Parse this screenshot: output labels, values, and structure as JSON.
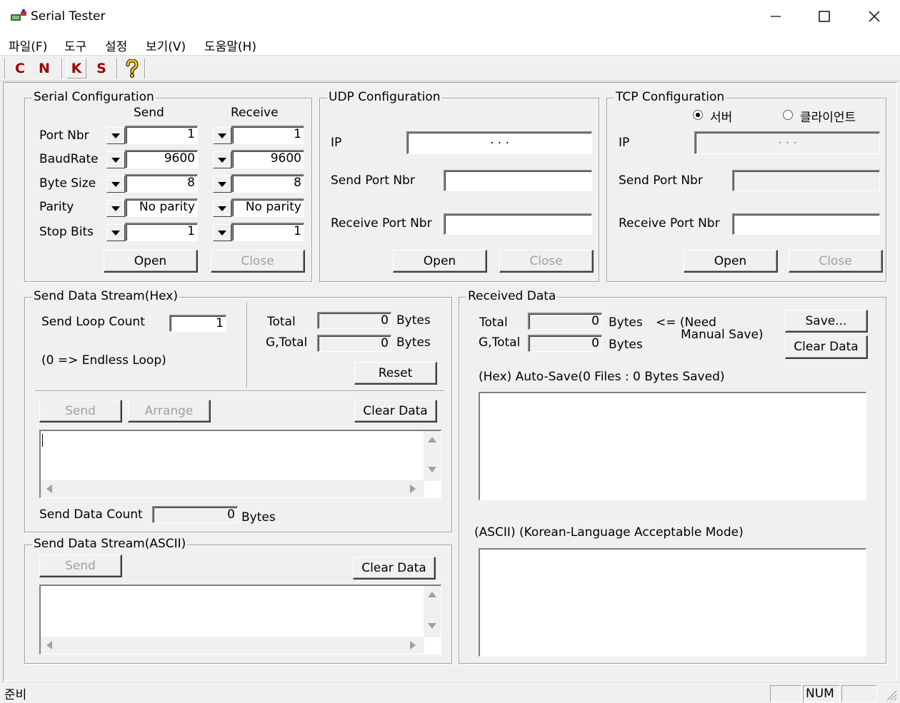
{
  "window": {
    "title": "Serial Tester",
    "icons": {
      "app": "serial-app-icon",
      "minimize": "minimize-icon",
      "maximize": "maximize-icon",
      "close": "close-icon"
    }
  },
  "menu": [
    "파일(F)",
    "도구",
    "설정",
    "보기(V)",
    "도움말(H)"
  ],
  "toolbar": {
    "buttons": [
      "C",
      "N",
      "K",
      "S"
    ],
    "help_icon": "help-question-icon",
    "letter_color": "#a00000",
    "help_color": "#e8c800"
  },
  "serial": {
    "title": "Serial Configuration",
    "send_header": "Send",
    "receive_header": "Receive",
    "rows": [
      {
        "label": "Port Nbr",
        "send": "1",
        "receive": "1"
      },
      {
        "label": "BaudRate",
        "send": "9600",
        "receive": "9600"
      },
      {
        "label": "Byte Size",
        "send": "8",
        "receive": "8"
      },
      {
        "label": "Parity",
        "send": "No parity",
        "receive": "No parity"
      },
      {
        "label": "Stop Bits",
        "send": "1",
        "receive": "1"
      }
    ],
    "open": "Open",
    "close": "Close"
  },
  "udp": {
    "title": "UDP Configuration",
    "ip_label": "IP",
    "ip_dots": ".          .          .",
    "send_port_label": "Send Port Nbr",
    "recv_port_label": "Receive Port Nbr",
    "open": "Open",
    "close": "Close"
  },
  "tcp": {
    "title": "TCP Configuration",
    "server_label": "서버",
    "client_label": "클라이언트",
    "ip_label": "IP",
    "ip_dots": ".          .          .",
    "send_port_label": "Send Port Nbr",
    "recv_port_label": "Receive Port Nbr",
    "open": "Open",
    "close": "Close"
  },
  "send_hex": {
    "title": "Send Data Stream(Hex)",
    "loop_label": "Send Loop Count",
    "loop_value": "1",
    "endless_note": "(0 => Endless Loop)",
    "total_label": "Total",
    "total_value": "0",
    "gtotal_label": "G,Total",
    "gtotal_value": "0",
    "bytes": "Bytes",
    "reset": "Reset",
    "send": "Send",
    "arrange": "Arrange",
    "clear": "Clear Data",
    "count_label": "Send Data Count",
    "count_value": "0",
    "count_unit": "Bytes"
  },
  "send_ascii": {
    "title": "Send Data Stream(ASCII)",
    "send": "Send",
    "clear": "Clear Data"
  },
  "received": {
    "title": "Received Data",
    "total_label": "Total",
    "total_value": "0",
    "gtotal_label": "G,Total",
    "gtotal_value": "0",
    "bytes": "Bytes",
    "need_save_1": "<= (Need",
    "need_save_2": "Manual Save)",
    "save": "Save...",
    "clear": "Clear Data",
    "hex_label": "(Hex)  Auto-Save(0 Files : 0 Bytes Saved)",
    "ascii_label": "(ASCII)  (Korean-Language Acceptable Mode)"
  },
  "status": {
    "text": "준비",
    "num": "NUM"
  }
}
